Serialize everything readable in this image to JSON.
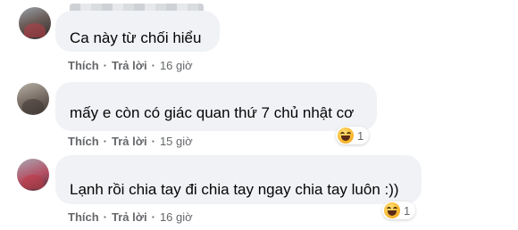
{
  "comments": [
    {
      "text": "Ca này từ chối hiểu",
      "actions": {
        "like": "Thích",
        "reply": "Trả lời",
        "time": "16 giờ"
      }
    },
    {
      "text": "mấy e còn có giác quan thứ 7 chủ nhật cơ",
      "actions": {
        "like": "Thích",
        "reply": "Trả lời",
        "time": "15 giờ"
      },
      "reaction": {
        "icon": "haha-emoji-icon",
        "count": "1"
      }
    },
    {
      "text": "Lạnh rồi chia tay đi chia tay ngay chia tay luôn :))",
      "actions": {
        "like": "Thích",
        "reply": "Trả lời",
        "time": "16 giờ"
      },
      "reaction": {
        "icon": "haha-emoji-icon",
        "count": "1"
      }
    }
  ],
  "separator": "·"
}
